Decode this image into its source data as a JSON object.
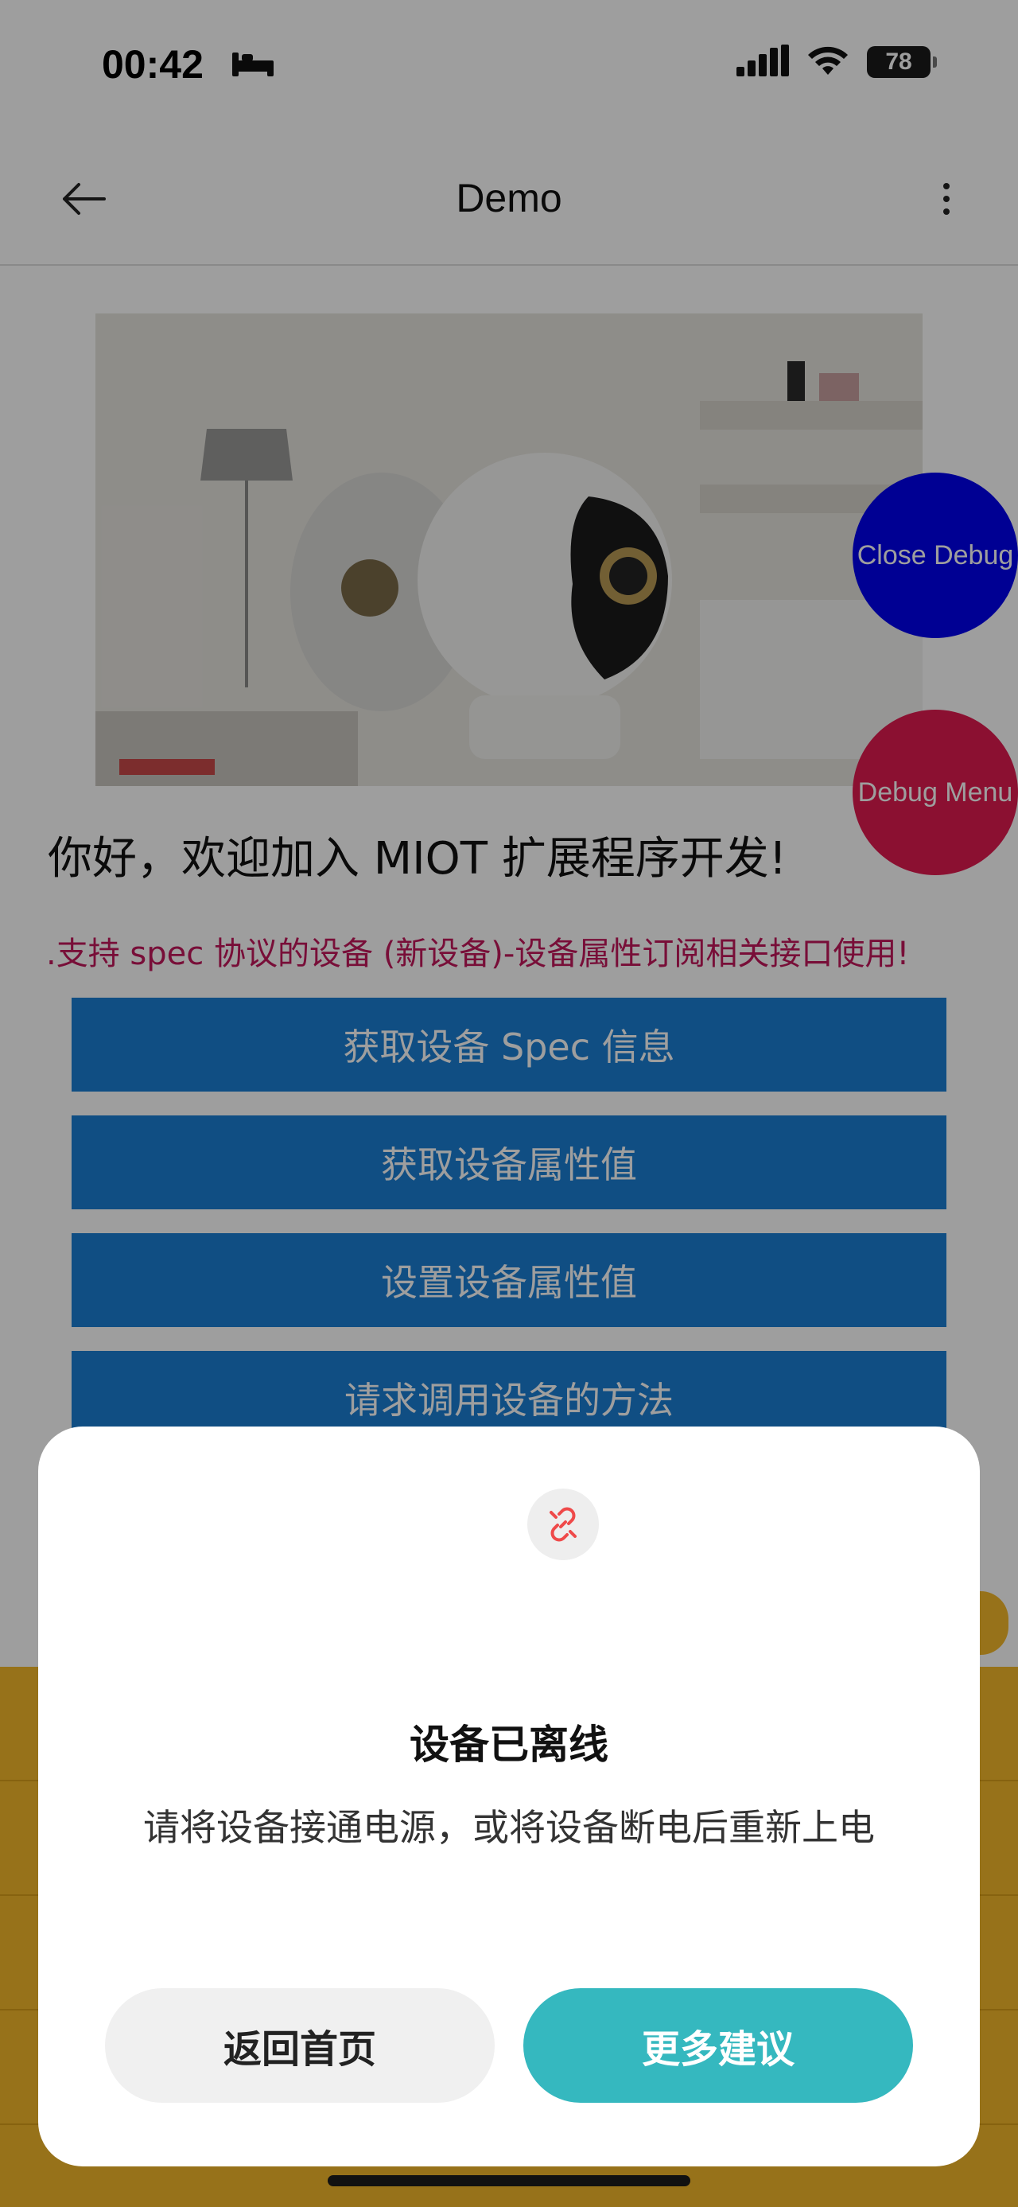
{
  "status_bar": {
    "time": "00:42",
    "battery": "78"
  },
  "nav": {
    "title": "Demo"
  },
  "main": {
    "welcome": "你好，欢迎加入 MIOT 扩展程序开发!",
    "subtitle": ".支持 spec 协议的设备 (新设备)-设备属性订阅相关接口使用!",
    "buttons": [
      "获取设备 Spec 信息",
      "获取设备属性值",
      "设置设备属性值",
      "请求调用设备的方法"
    ]
  },
  "debug": {
    "close_label": "Close Debug",
    "menu_label": "Debug Menu",
    "close_color": "#0000ee",
    "menu_color": "#e01a4f"
  },
  "modal": {
    "title": "设备已离线",
    "message": "请将设备接通电源，或将设备断电后重新上电",
    "back_label": "返回首页",
    "more_label": "更多建议"
  }
}
